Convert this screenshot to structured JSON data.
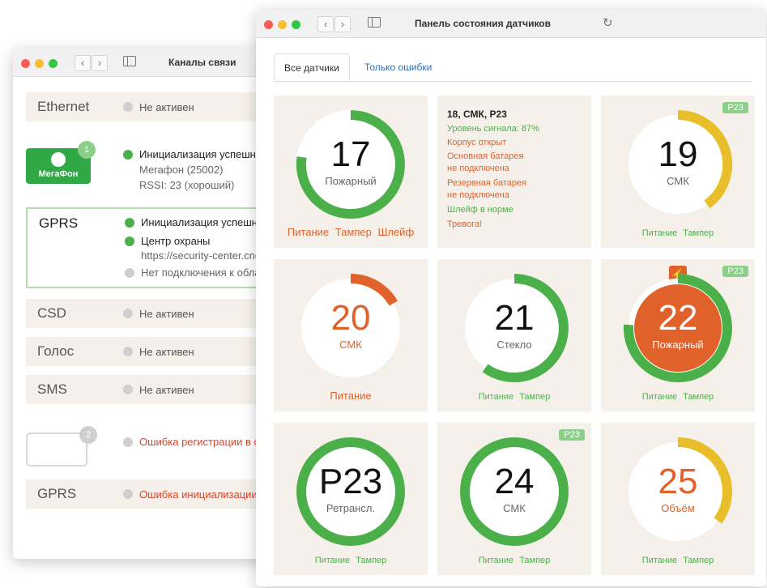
{
  "left_window": {
    "title": "Каналы связи",
    "rows": {
      "ethernet": {
        "name": "Ethernet",
        "status": "Не активен"
      },
      "megafon": {
        "badge": "1",
        "logo_text": "МегаФон",
        "lines": [
          "Инициализация успешно",
          "Мегафон (25002)",
          "RSSI: 23 (хороший)"
        ]
      },
      "gprs1": {
        "name": "GPRS",
        "line1": "Инициализация успешно",
        "line2": "Центр охраны",
        "line3": "https://security-center.cnor",
        "line4": "Нет подключения к облак"
      },
      "csd": {
        "name": "CSD",
        "status": "Не активен"
      },
      "voice": {
        "name": "Голос",
        "status": "Не активен"
      },
      "sms": {
        "name": "SMS",
        "status": "Не активен"
      },
      "sim2": {
        "badge": "2",
        "status": "Ошибка регистрации в се"
      },
      "gprs2": {
        "name": "GPRS",
        "status": "Ошибка инициализации С"
      }
    }
  },
  "right_window": {
    "title": "Панель состояния датчиков",
    "tabs": [
      "Все датчики",
      "Только ошибки"
    ],
    "cards": {
      "c17": {
        "number": "17",
        "label": "Пожарный",
        "footer": [
          "Питание",
          "Тампер",
          "Шлейф"
        ]
      },
      "info": {
        "head": "18, СМК, Р23",
        "lines": [
          "Уровень сигнала: 87%",
          "Корпус открыт",
          "Основная батарея",
          "не подключена",
          "Резервная батарея",
          "не подключена",
          "Шлейф в норме",
          "Тревога!"
        ]
      },
      "c19": {
        "badge": "Р23",
        "number": "19",
        "label": "СМК",
        "footer": [
          "Питание",
          "Тампер"
        ]
      },
      "c20": {
        "number": "20",
        "label": "СМК",
        "footer": [
          "Питание"
        ]
      },
      "c21": {
        "number": "21",
        "label": "Стекло",
        "footer": [
          "Питание",
          "Тампер"
        ]
      },
      "c22": {
        "badge": "Р23",
        "number": "22",
        "label": "Пожарный",
        "footer": [
          "Питание",
          "Тампер"
        ]
      },
      "c23": {
        "number": "Р23",
        "label": "Ретрансл.",
        "footer": [
          "Питание",
          "Тампер"
        ]
      },
      "c24": {
        "badge": "Р23",
        "number": "24",
        "label": "СМК",
        "footer": [
          "Питание",
          "Тампер"
        ]
      },
      "c25": {
        "number": "25",
        "label": "Объём",
        "footer": [
          "Питание",
          "Тампер"
        ]
      }
    }
  },
  "colors": {
    "green": "#4cb04a",
    "orange": "#e1612a",
    "yellow": "#e8bf2a",
    "card_bg": "#f5f1ea"
  }
}
